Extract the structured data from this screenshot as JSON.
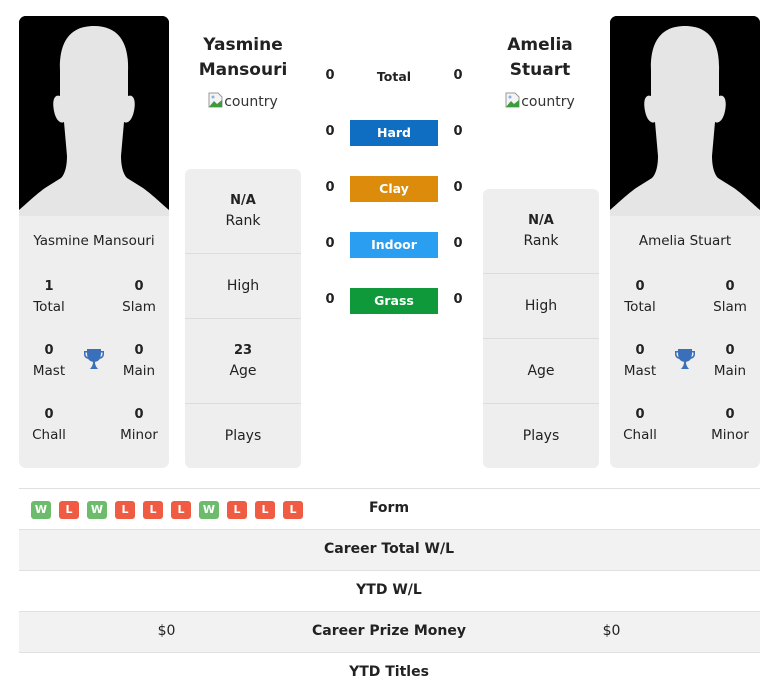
{
  "colors": {
    "hard": "#0f6ec2",
    "clay": "#dc8b0a",
    "indoor": "#2a9ff2",
    "grass": "#10993a",
    "win": "#6cbc6c",
    "loss": "#ef5b43",
    "trophy": "#3a6fba"
  },
  "player1": {
    "name": "Yasmine Mansouri",
    "title_line1": "Yasmine",
    "title_line2": "Mansouri",
    "country_alt": "country",
    "titles": {
      "total": "1",
      "total_label": "Total",
      "slam": "0",
      "slam_label": "Slam",
      "mast": "0",
      "mast_label": "Mast",
      "main": "0",
      "main_label": "Main",
      "chall": "0",
      "chall_label": "Chall",
      "minor": "0",
      "minor_label": "Minor"
    },
    "info": {
      "rank": "N/A",
      "rank_label": "Rank",
      "high_label": "High",
      "age": "23",
      "age_label": "Age",
      "plays_label": "Plays"
    }
  },
  "player2": {
    "name": "Amelia Stuart",
    "title_line1": "Amelia",
    "title_line2": "Stuart",
    "country_alt": "country",
    "titles": {
      "total": "0",
      "total_label": "Total",
      "slam": "0",
      "slam_label": "Slam",
      "mast": "0",
      "mast_label": "Mast",
      "main": "0",
      "main_label": "Main",
      "chall": "0",
      "chall_label": "Chall",
      "minor": "0",
      "minor_label": "Minor"
    },
    "info": {
      "rank": "N/A",
      "rank_label": "Rank",
      "high_label": "High",
      "age_label": "Age",
      "plays_label": "Plays"
    }
  },
  "h2h": {
    "total": {
      "label": "Total",
      "p1": "0",
      "p2": "0"
    },
    "hard": {
      "label": "Hard",
      "p1": "0",
      "p2": "0"
    },
    "clay": {
      "label": "Clay",
      "p1": "0",
      "p2": "0"
    },
    "indoor": {
      "label": "Indoor",
      "p1": "0",
      "p2": "0"
    },
    "grass": {
      "label": "Grass",
      "p1": "0",
      "p2": "0"
    }
  },
  "table": {
    "form_label": "Form",
    "form_p1": [
      "W",
      "L",
      "W",
      "L",
      "L",
      "L",
      "W",
      "L",
      "L",
      "L"
    ],
    "career_wl_label": "Career Total W/L",
    "ytd_wl_label": "YTD W/L",
    "prize_label": "Career Prize Money",
    "prize_p1": "$0",
    "prize_p2": "$0",
    "ytd_titles_label": "YTD Titles"
  }
}
